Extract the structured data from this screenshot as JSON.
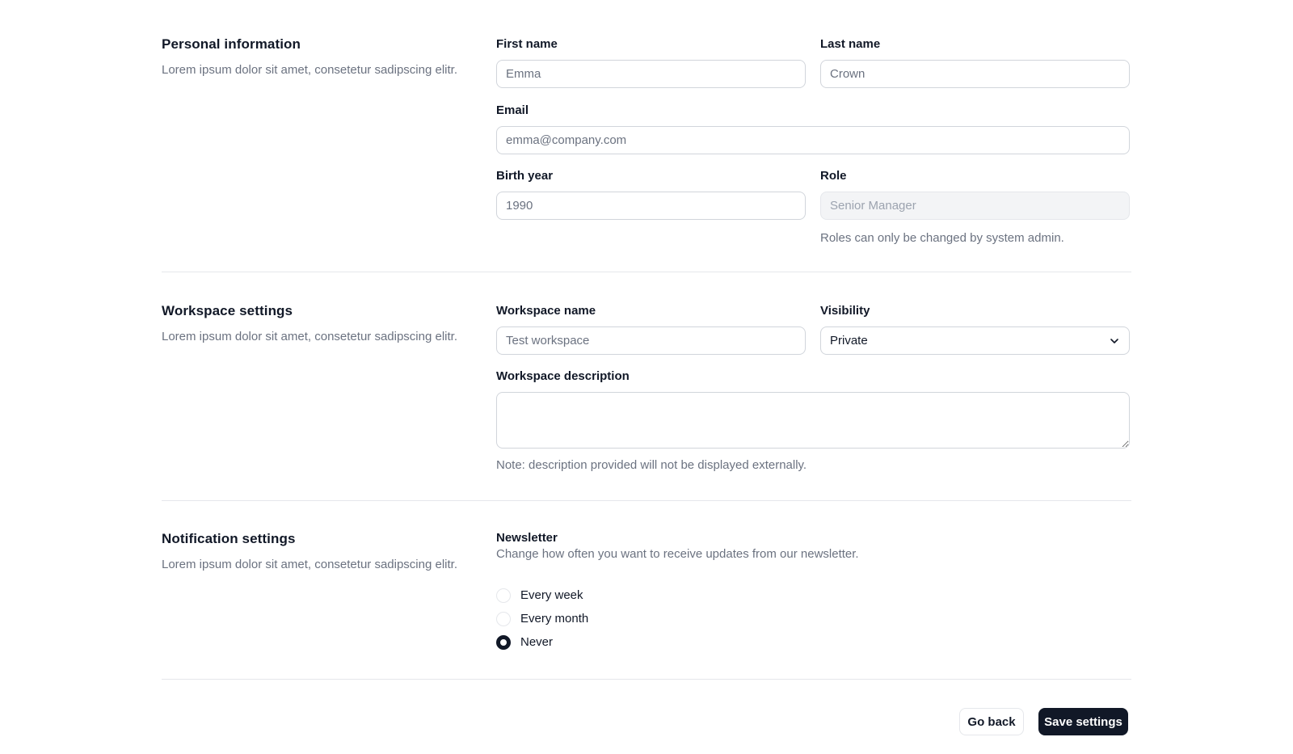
{
  "personal": {
    "title": "Personal information",
    "description": "Lorem ipsum dolor sit amet, consetetur sadipscing elitr.",
    "first_name": {
      "label": "First name",
      "placeholder": "Emma"
    },
    "last_name": {
      "label": "Last name",
      "placeholder": "Crown"
    },
    "email": {
      "label": "Email",
      "placeholder": "emma@company.com"
    },
    "birth_year": {
      "label": "Birth year",
      "placeholder": "1990"
    },
    "role": {
      "label": "Role",
      "placeholder": "Senior Manager",
      "hint": "Roles can only be changed by system admin."
    }
  },
  "workspace": {
    "title": "Workspace settings",
    "description": "Lorem ipsum dolor sit amet, consetetur sadipscing elitr.",
    "name": {
      "label": "Workspace name",
      "placeholder": "Test workspace"
    },
    "visibility": {
      "label": "Visibility",
      "selected": "Private"
    },
    "desc_field": {
      "label": "Workspace description",
      "note": "Note: description provided will not be displayed externally."
    }
  },
  "notifications": {
    "title": "Notification settings",
    "description": "Lorem ipsum dolor sit amet, consetetur sadipscing elitr.",
    "newsletter_title": "Newsletter",
    "newsletter_desc": "Change how often you want to receive updates from our newsletter.",
    "options": [
      {
        "label": "Every week",
        "checked": false
      },
      {
        "label": "Every month",
        "checked": false
      },
      {
        "label": "Never",
        "checked": true
      }
    ]
  },
  "actions": {
    "back_label": "Go back",
    "save_label": "Save settings"
  },
  "icons": {
    "visibility_chevron": "chevron-down-icon"
  },
  "colors": {
    "primary": "#111827",
    "muted_text": "#6b7280",
    "border": "#d1d5db",
    "divider": "#e5e7eb"
  }
}
